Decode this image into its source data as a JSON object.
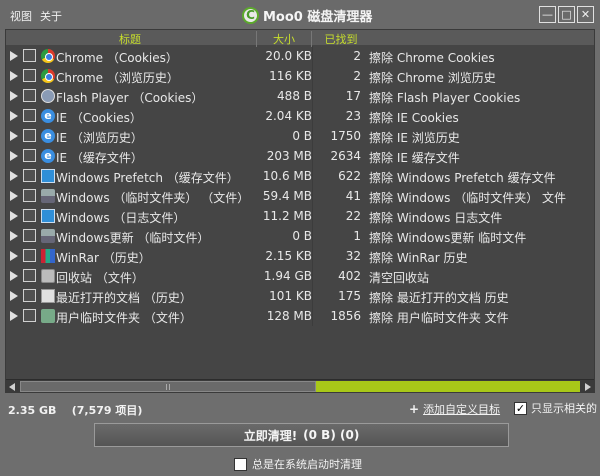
{
  "menu": {
    "view": "视图",
    "about": "关于"
  },
  "app": {
    "logo_letter": "C",
    "title": "Moo0 磁盘清理器"
  },
  "window_buttons": {
    "minimize": "—",
    "maximize": "□",
    "close": "✕"
  },
  "table": {
    "headers": {
      "title": "标题",
      "size": "大小",
      "found": "已找到",
      "desc": ""
    },
    "rows": [
      {
        "icon": "chrome-icon",
        "name": "Chrome （Cookies）",
        "size": "20.0 KB",
        "found": "2",
        "desc": "擦除 Chrome Cookies"
      },
      {
        "icon": "chrome-icon",
        "name": "Chrome （浏览历史）",
        "size": "116 KB",
        "found": "2",
        "desc": "擦除 Chrome 浏览历史"
      },
      {
        "icon": "flash-icon",
        "name": "Flash Player （Cookies）",
        "size": "488 B",
        "found": "17",
        "desc": "擦除 Flash Player Cookies"
      },
      {
        "icon": "ie-icon",
        "name": "IE （Cookies）",
        "size": "2.04 KB",
        "found": "23",
        "desc": "擦除 IE Cookies"
      },
      {
        "icon": "ie-icon",
        "name": "IE （浏览历史）",
        "size": "0 B",
        "found": "1750",
        "desc": "擦除 IE 浏览历史"
      },
      {
        "icon": "ie-icon",
        "name": "IE （缓存文件）",
        "size": "203 MB",
        "found": "2634",
        "desc": "擦除 IE 缓存文件"
      },
      {
        "icon": "monitor-icon",
        "name": "Windows Prefetch （缓存文件）",
        "size": "10.6 MB",
        "found": "622",
        "desc": "擦除 Windows Prefetch 缓存文件"
      },
      {
        "icon": "drive-icon",
        "name": "Windows （临时文件夹） （文件）",
        "size": "59.4 MB",
        "found": "41",
        "desc": "擦除 Windows （临时文件夹） 文件"
      },
      {
        "icon": "monitor-icon",
        "name": "Windows （日志文件）",
        "size": "11.2 MB",
        "found": "22",
        "desc": "擦除 Windows 日志文件"
      },
      {
        "icon": "drive-icon",
        "name": "Windows更新 （临时文件）",
        "size": "0 B",
        "found": "1",
        "desc": "擦除 Windows更新 临时文件"
      },
      {
        "icon": "winrar-icon",
        "name": "WinRar （历史）",
        "size": "2.15 KB",
        "found": "32",
        "desc": "擦除 WinRar 历史"
      },
      {
        "icon": "recycle-bin-icon",
        "name": "回收站 （文件）",
        "size": "1.94 GB",
        "found": "402",
        "desc": "清空回收站"
      },
      {
        "icon": "recent-docs-icon",
        "name": "最近打开的文档 （历史）",
        "size": "101 KB",
        "found": "175",
        "desc": "擦除 最近打开的文档 历史"
      },
      {
        "icon": "temp-folder-icon",
        "name": "用户临时文件夹 （文件）",
        "size": "128 MB",
        "found": "1856",
        "desc": "擦除 用户临时文件夹 文件"
      }
    ]
  },
  "footer": {
    "total_size": "2.35 GB",
    "total_items": "(7,579 项目)",
    "add_filter_plus": "+",
    "add_filter": "添加自定义目标",
    "only_relevant": "只显示相关的",
    "only_relevant_checked": true,
    "clean_label": "立即清理!",
    "clean_summary": "(0 B) (0)",
    "autostart": "总是在系统启动时清理",
    "autostart_checked": false
  },
  "colors": {
    "accent": "#c6dd2c",
    "bar_green": "#a8c818",
    "background": "#6e6e6e",
    "table_bg": "#454545"
  }
}
